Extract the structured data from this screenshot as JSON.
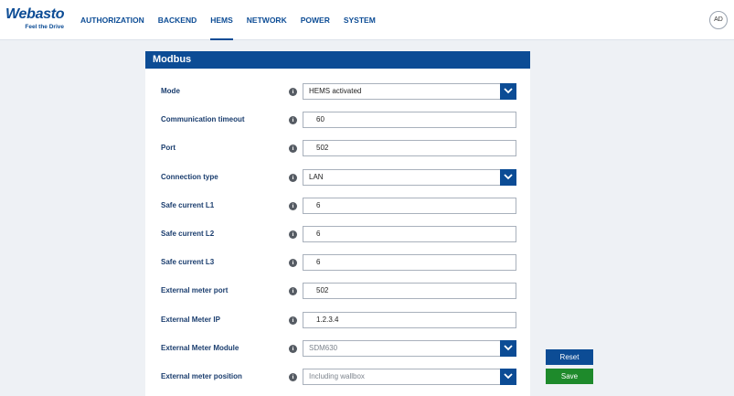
{
  "brand": {
    "name": "Webasto",
    "tagline": "Feel the Drive",
    "color": "#0c4c95"
  },
  "nav": {
    "items": [
      {
        "label": "AUTHORIZATION",
        "active": false
      },
      {
        "label": "BACKEND",
        "active": false
      },
      {
        "label": "HEMS",
        "active": true
      },
      {
        "label": "NETWORK",
        "active": false
      },
      {
        "label": "POWER",
        "active": false
      },
      {
        "label": "SYSTEM",
        "active": false
      }
    ]
  },
  "user": {
    "initials": "AD"
  },
  "panel": {
    "title": "Modbus",
    "rows": [
      {
        "label": "Mode",
        "type": "select",
        "value": "HEMS activated",
        "disabled": false
      },
      {
        "label": "Communication timeout",
        "type": "input",
        "value": "60",
        "disabled": false
      },
      {
        "label": "Port",
        "type": "input",
        "value": "502",
        "disabled": false
      },
      {
        "label": "Connection type",
        "type": "select",
        "value": "LAN",
        "disabled": false
      },
      {
        "label": "Safe current L1",
        "type": "input",
        "value": "6",
        "disabled": false
      },
      {
        "label": "Safe current L2",
        "type": "input",
        "value": "6",
        "disabled": false
      },
      {
        "label": "Safe current L3",
        "type": "input",
        "value": "6",
        "disabled": false
      },
      {
        "label": "External meter port",
        "type": "input",
        "value": "502",
        "disabled": false
      },
      {
        "label": "External Meter IP",
        "type": "input",
        "value": "1.2.3.4",
        "disabled": false
      },
      {
        "label": "External Meter Module",
        "type": "select",
        "value": "SDM630",
        "disabled": true
      },
      {
        "label": "External meter position",
        "type": "select",
        "value": "Including wallbox",
        "disabled": true
      }
    ]
  },
  "actions": {
    "reset_label": "Reset",
    "save_label": "Save"
  },
  "colors": {
    "accent": "#0c4c95",
    "save": "#1e8a2b",
    "background": "#eef1f5"
  }
}
